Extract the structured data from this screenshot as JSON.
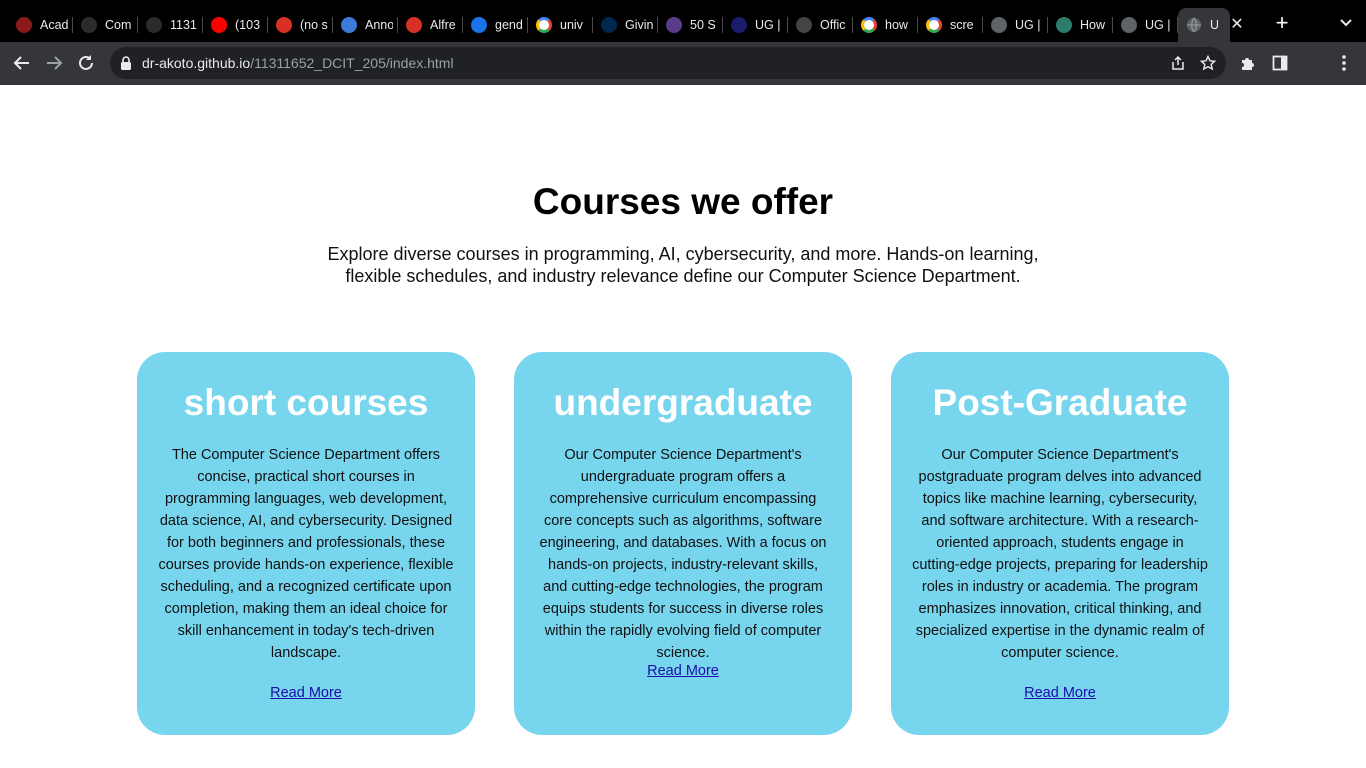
{
  "browser": {
    "tabs": [
      {
        "title": "Acad",
        "icon": "red-crest-icon",
        "color": "#8b1a1a"
      },
      {
        "title": "Com",
        "icon": "github-icon",
        "color": "#2b2b2b"
      },
      {
        "title": "1131",
        "icon": "github-icon",
        "color": "#2b2b2b"
      },
      {
        "title": "(103",
        "icon": "youtube-icon",
        "color": "#ff0000"
      },
      {
        "title": "(no s",
        "icon": "gmail-icon",
        "color": "#d93025"
      },
      {
        "title": "Anno",
        "icon": "doc-icon",
        "color": "#3c7bd9"
      },
      {
        "title": "Alfre",
        "icon": "gmail-icon",
        "color": "#d93025"
      },
      {
        "title": "gend",
        "icon": "search-icon",
        "color": "#1a73e8"
      },
      {
        "title": "univ",
        "icon": "google-icon",
        "color": "#ffffff"
      },
      {
        "title": "Givin",
        "icon": "michigan-icon",
        "color": "#00274c"
      },
      {
        "title": "50 S",
        "icon": "crest-icon",
        "color": "#5b3c88"
      },
      {
        "title": "UG |",
        "icon": "dots-icon",
        "color": "#1b1b6b"
      },
      {
        "title": "Offic",
        "icon": "globe-icon",
        "color": "#444444"
      },
      {
        "title": "how",
        "icon": "google-icon",
        "color": "#ffffff"
      },
      {
        "title": "scre",
        "icon": "google-icon",
        "color": "#ffffff"
      },
      {
        "title": "UG |",
        "icon": "globe-icon",
        "color": "#5f6368"
      },
      {
        "title": "How",
        "icon": "ub-icon",
        "color": "#2e7d6b"
      },
      {
        "title": "UG |",
        "icon": "globe-icon",
        "color": "#5f6368"
      }
    ],
    "active_tab": {
      "title": "U",
      "icon": "globe-icon",
      "color": "#5f6368"
    },
    "new_tab_label": "+",
    "url_host": "dr-akoto.github.io",
    "url_path": "/11311652_DCIT_205/index.html"
  },
  "page": {
    "title": "Courses we offer",
    "intro": "Explore diverse courses in programming, AI, cybersecurity, and more. Hands-on learning, flexible schedules, and industry relevance define our Computer Science Department.",
    "card_color": "#78d5ee",
    "cards": [
      {
        "heading": "short courses",
        "body": "The Computer Science Department offers concise, practical short courses in programming languages, web development, data science, AI, and cybersecurity. Designed for both beginners and professionals, these courses provide hands-on experience, flexible scheduling, and a recognized certificate upon completion, making them an ideal choice for skill enhancement in today's tech-driven landscape.",
        "link": "Read More"
      },
      {
        "heading": "undergraduate",
        "body": "Our Computer Science Department's undergraduate program offers a comprehensive curriculum encompassing core concepts such as algorithms, software engineering, and databases. With a focus on hands-on projects, industry-relevant skills, and cutting-edge technologies, the program equips students for success in diverse roles within the rapidly evolving field of computer science.",
        "link": "Read More"
      },
      {
        "heading": "Post-Graduate",
        "body": "Our Computer Science Department's postgraduate program delves into advanced topics like machine learning, cybersecurity, and software architecture. With a research-oriented approach, students engage in cutting-edge projects, preparing for leadership roles in industry or academia. The program emphasizes innovation, critical thinking, and specialized expertise in the dynamic realm of computer science.",
        "link": "Read More"
      }
    ]
  }
}
